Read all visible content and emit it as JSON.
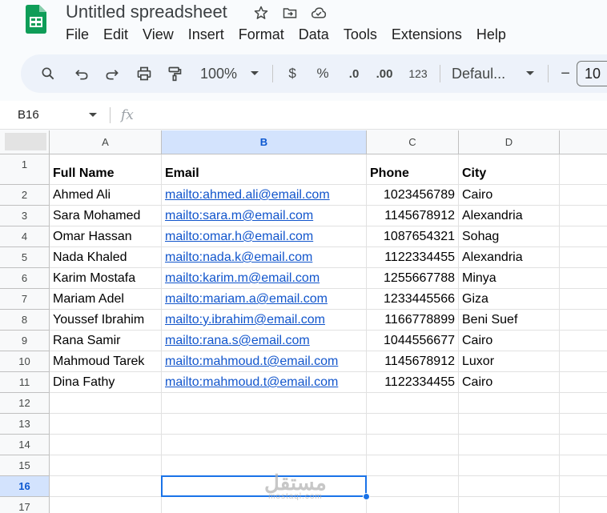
{
  "app": {
    "title": "Untitled spreadsheet",
    "menu": [
      "File",
      "Edit",
      "View",
      "Insert",
      "Format",
      "Data",
      "Tools",
      "Extensions",
      "Help"
    ]
  },
  "toolbar": {
    "zoom": "100%",
    "currency": "$",
    "percent": "%",
    "decrease_decimal": ".0",
    "increase_decimal": ".00",
    "number_format": "123",
    "font": "Defaul...",
    "font_size": "10",
    "minus": "−"
  },
  "formula_bar": {
    "name_box": "B16",
    "fx": "fx",
    "content": ""
  },
  "sheet": {
    "columns": [
      "A",
      "B",
      "C",
      "D"
    ],
    "selected_column": "B",
    "selected_row": "16",
    "header_row": [
      "Full Name",
      "Email",
      "Phone",
      "City"
    ],
    "rows": [
      {
        "name": "Ahmed Ali",
        "email": "mailto:ahmed.ali@email.com",
        "phone": "1023456789",
        "city": "Cairo"
      },
      {
        "name": "Sara Mohamed",
        "email": "mailto:sara.m@email.com",
        "phone": "1145678912",
        "city": "Alexandria"
      },
      {
        "name": "Omar Hassan",
        "email": "mailto:omar.h@email.com",
        "phone": "1087654321",
        "city": "Sohag"
      },
      {
        "name": "Nada Khaled",
        "email": "mailto:nada.k@email.com",
        "phone": "1122334455",
        "city": "Alexandria"
      },
      {
        "name": "Karim Mostafa",
        "email": "mailto:karim.m@email.com",
        "phone": "1255667788",
        "city": "Minya"
      },
      {
        "name": "Mariam Adel",
        "email": "mailto:mariam.a@email.com",
        "phone": "1233445566",
        "city": "Giza"
      },
      {
        "name": "Youssef Ibrahim",
        "email": "mailto:y.ibrahim@email.com",
        "phone": "1166778899",
        "city": "Beni Suef"
      },
      {
        "name": "Rana Samir",
        "email": "mailto:rana.s@email.com",
        "phone": "1044556677",
        "city": "Cairo"
      },
      {
        "name": "Mahmoud Tarek",
        "email": "mailto:mahmoud.t@email.com",
        "phone": "1145678912",
        "city": "Luxor"
      },
      {
        "name": "Dina Fathy",
        "email": "mailto:mahmoud.t@email.com",
        "phone": "1122334455",
        "city": "Cairo"
      }
    ],
    "row_numbers": [
      "1",
      "2",
      "3",
      "4",
      "5",
      "6",
      "7",
      "8",
      "9",
      "10",
      "11",
      "12",
      "13",
      "14",
      "15",
      "16",
      "17"
    ]
  },
  "watermark": {
    "main": "مستقل",
    "sub": "mostaql.com"
  },
  "colors": {
    "accent": "#1a73e8",
    "link": "#1155cc",
    "selected_header": "#d3e3fd",
    "sheets_green": "#0f9d58"
  }
}
